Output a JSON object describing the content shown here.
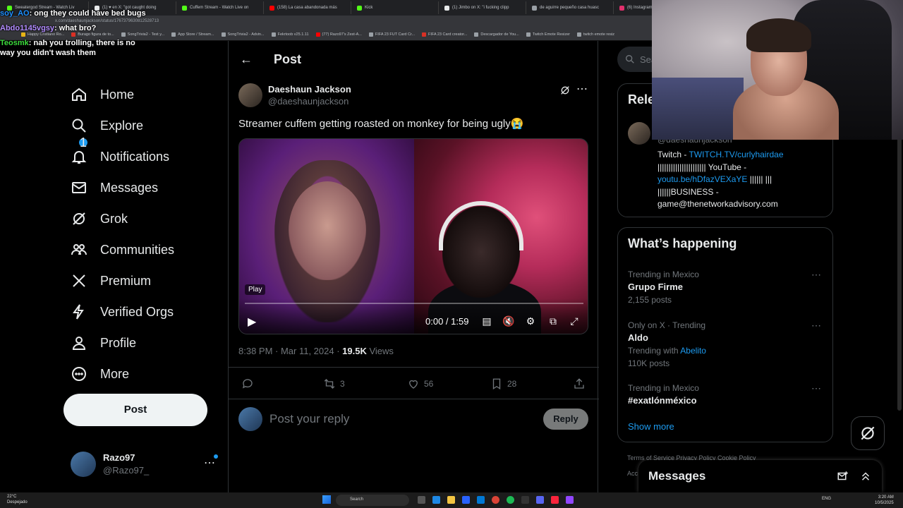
{
  "browser": {
    "tabs": [
      {
        "label": "Sweatergod Stream - Watch Liv",
        "color": "#53fc18"
      },
      {
        "label": "(1) ♥ en X: \"got caught doing",
        "color": "#e7e9ea"
      },
      {
        "label": "Cuffem Stream - Watch Live on",
        "color": "#53fc18"
      },
      {
        "label": "(158) La casa abandonada más",
        "color": "#ff0000"
      },
      {
        "label": "Kick",
        "color": "#53fc18"
      },
      {
        "label": "(1) Jimbo on X: \"i fucking clipp",
        "color": "#e7e9ea"
      },
      {
        "label": "de aguirre pequeño casa huasc",
        "color": "#9aa0a6"
      },
      {
        "label": "(6) Instagram",
        "color": "#e1306c"
      }
    ],
    "url": "x.com/daeshaunjackson/status/1767379630812528713",
    "bookmarks": [
      {
        "label": "Happy Cristiano Ro...",
        "color": "#e7b416"
      },
      {
        "label": "Burago figura de to...",
        "color": "#d93025"
      },
      {
        "label": "SongTrivia2 - Test y...",
        "color": "#9aa0a6"
      },
      {
        "label": "App Store / Stream...",
        "color": "#9aa0a6"
      },
      {
        "label": "SongTrivia2 - Advin...",
        "color": "#9aa0a6"
      },
      {
        "label": "Fekrtoob v25.1.11",
        "color": "#9aa0a6"
      },
      {
        "label": "(77) Razo97's Zest-A...",
        "color": "#ff0000"
      },
      {
        "label": "FIFA 23 FUT Card Cr...",
        "color": "#9aa0a6"
      },
      {
        "label": "FIFA 23 Card creator...",
        "color": "#d93025"
      },
      {
        "label": "Descargador de You...",
        "color": "#9aa0a6"
      },
      {
        "label": "Twitch Emote Resizer",
        "color": "#9aa0a6"
      },
      {
        "label": "twitch emote resiz",
        "color": "#9aa0a6"
      }
    ]
  },
  "chat": [
    {
      "user": "soy_AO",
      "msg": ": ong they could have bed bugs",
      "color": "#1e90ff"
    },
    {
      "user": "Abdo1145vgsy",
      "msg": ": what bro?",
      "color": "#b28cff"
    },
    {
      "user": "Teosmk",
      "msg": ": nah you trolling, there is no way you didn't wash them",
      "color": "#3cdc3c"
    }
  ],
  "nav": {
    "items": [
      {
        "label": "Home",
        "icon": "home-icon"
      },
      {
        "label": "Explore",
        "icon": "search-icon"
      },
      {
        "label": "Notifications",
        "icon": "bell-icon",
        "badge": "1"
      },
      {
        "label": "Messages",
        "icon": "mail-icon"
      },
      {
        "label": "Grok",
        "icon": "grok-icon"
      },
      {
        "label": "Communities",
        "icon": "communities-icon"
      },
      {
        "label": "Premium",
        "icon": "x-logo-icon"
      },
      {
        "label": "Verified Orgs",
        "icon": "lightning-icon"
      },
      {
        "label": "Profile",
        "icon": "person-icon"
      },
      {
        "label": "More",
        "icon": "more-circle-icon"
      }
    ],
    "post_label": "Post",
    "account": {
      "name": "Razo97",
      "handle": "@Razo97_"
    }
  },
  "post": {
    "header_title": "Post",
    "author_name": "Daeshaun Jackson",
    "author_handle": "@daeshaunjackson",
    "text": "Streamer cuffem getting roasted on monkey for being ugly😭",
    "video": {
      "play_label": "Play",
      "time": "0:00 / 1:59",
      "progress": 0
    },
    "timestamp": "8:38 PM · Mar 11, 2024 · ",
    "views_count": "19.5K",
    "views_label": " Views",
    "actions": {
      "replies": "",
      "reposts": "3",
      "likes": "56",
      "bookmarks": "28"
    },
    "reply_placeholder": "Post your reply",
    "reply_button": "Reply"
  },
  "right": {
    "search_placeholder": "Sea",
    "relevant_title": "Rele",
    "relevant_handle": "@daeshaunjackson",
    "bio": {
      "p1": "Twitch - ",
      "l1": "TWITCH.TV/curlyhairdae",
      "p2": " |||||||||||||||||||||| YouTube - ",
      "l2": "youtu.be/hDfazVEXaYE",
      "p3": " |||||| ||| ||||||BUSINESS - game@thenetworkadvisory.com"
    },
    "happening_title": "What’s happening",
    "trends": [
      {
        "context": "Trending in Mexico",
        "title": "Grupo Firme",
        "count": "2,155 posts",
        "with": "",
        "with_link": ""
      },
      {
        "context": "Only on X · Trending",
        "title": "Aldo",
        "count": "110K posts",
        "with": "Trending with ",
        "with_link": "Abelito"
      },
      {
        "context": "Trending in Mexico",
        "title": "#exatlónméxico",
        "count": "",
        "with": "",
        "with_link": ""
      }
    ],
    "show_more": "Show more",
    "footer1": "Terms of Service   Privacy Policy   Cookie Policy",
    "footer2": "Acc",
    "messages_title": "Messages"
  },
  "taskbar": {
    "weather_temp": "22°C",
    "weather_desc": "Despejado",
    "search": "Search",
    "lang": "ENG",
    "time": "3:20 AM",
    "date": "10/5/2025"
  }
}
